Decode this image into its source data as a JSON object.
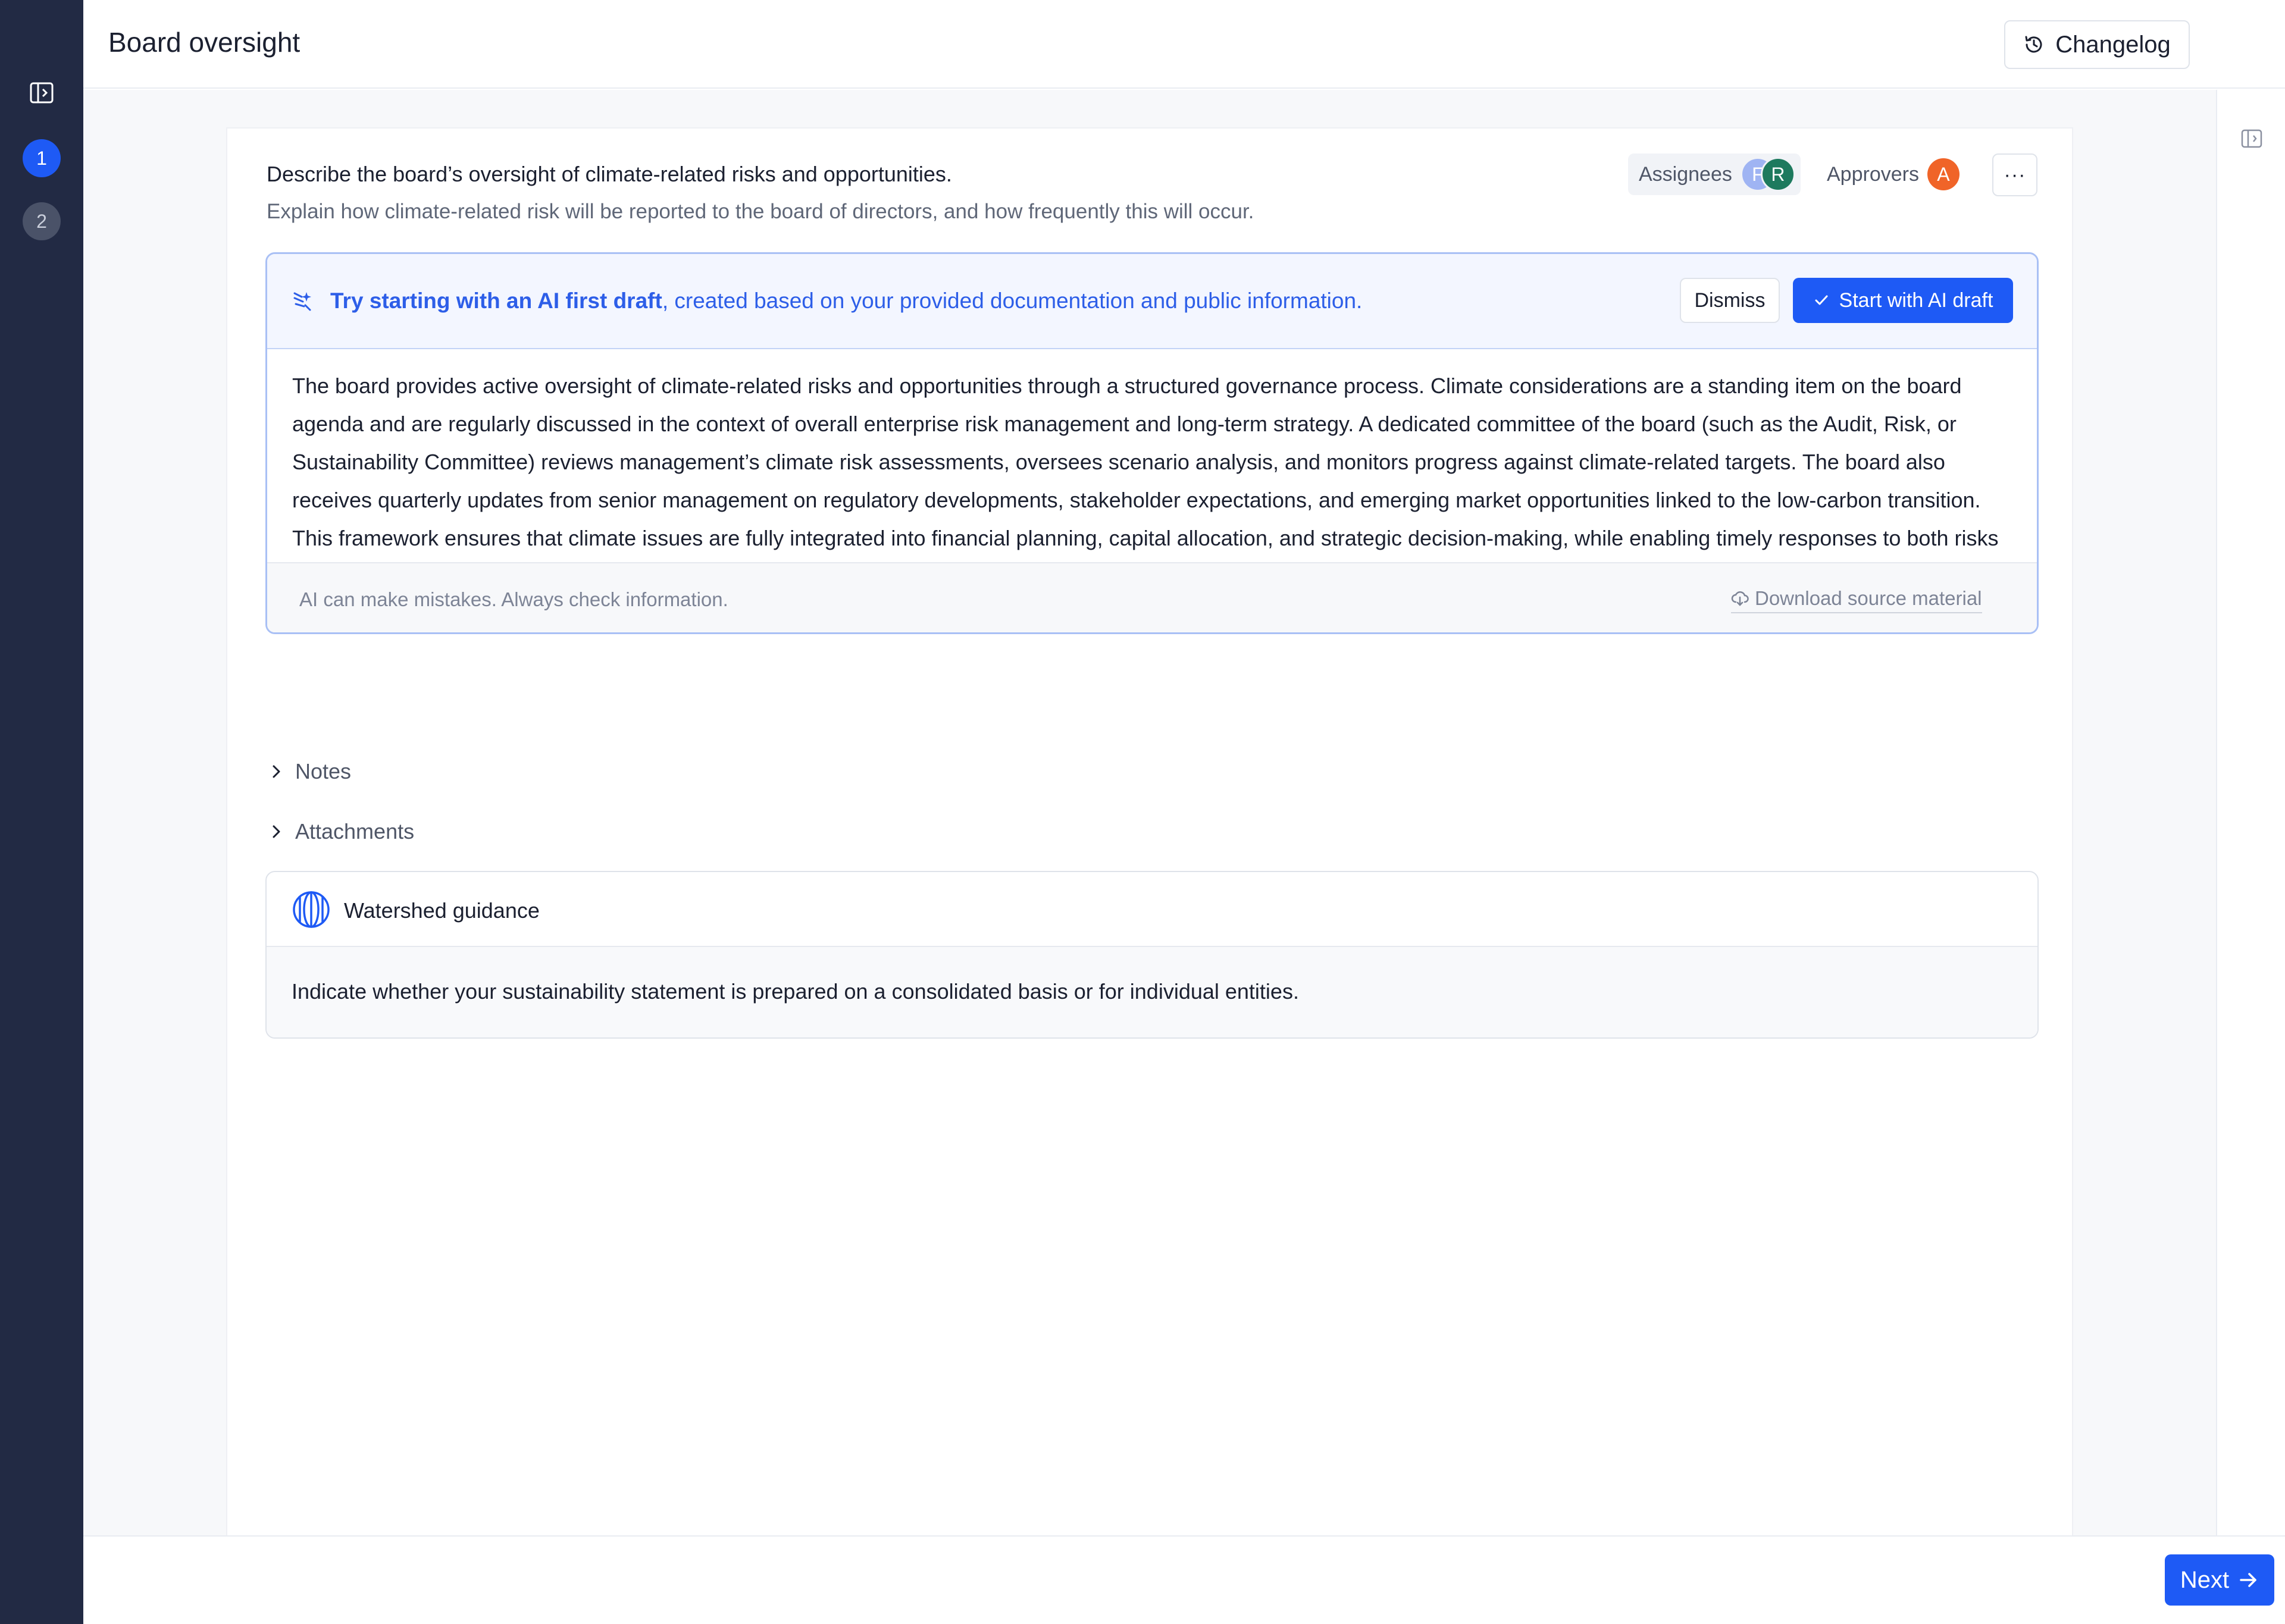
{
  "header": {
    "title": "Board oversight",
    "changelog_label": "Changelog"
  },
  "steps": [
    "1",
    "2"
  ],
  "question": {
    "title": "Describe the board’s oversight of climate-related risks and opportunities.",
    "subtitle": "Explain how climate-related risk will be reported to the board of directors, and how frequently this will occur.",
    "assignees_label": "Assignees",
    "assignee_initials": [
      "F",
      "R"
    ],
    "approvers_label": "Approvers",
    "approver_initials": [
      "A"
    ],
    "more_label": "···"
  },
  "ai_banner": {
    "lead": "Try starting with an AI first draft",
    "rest": ", created based on your provided documentation and public information.",
    "dismiss_label": "Dismiss",
    "start_label": "Start with AI draft"
  },
  "draft": {
    "text": "The board provides active oversight of climate-related risks and opportunities through a structured governance process. Climate considerations are a standing item on the board agenda and are regularly discussed in the context of overall enterprise risk management and long-term strategy. A dedicated committee of the board (such as the Audit, Risk, or Sustainability Committee) reviews management’s climate risk assessments, oversees scenario analysis, and monitors progress against climate-related targets. The board also receives quarterly updates from senior management on regulatory developments, stakeholder expectations, and emerging market opportunities linked to the low-carbon transition. This framework ensures that climate issues are fully integrated into financial planning, capital allocation, and strategic decision-making, while enabling timely responses to both risks and opportunities.",
    "disclaimer": "AI can make mistakes. Always check information.",
    "download_label": "Download source material"
  },
  "sections": {
    "notes_label": "Notes",
    "attachments_label": "Attachments"
  },
  "guidance": {
    "title": "Watershed guidance",
    "text": "Indicate whether your sustainability statement is prepared on a consolidated basis or for individual entities."
  },
  "footer": {
    "next_label": "Next"
  },
  "colors": {
    "accent": "#1e5af5",
    "rail": "#222a44",
    "approver_avatar": "#f06428",
    "assignee_avatar_r": "#1e7a5e",
    "assignee_avatar_f": "#9fb4f3"
  }
}
